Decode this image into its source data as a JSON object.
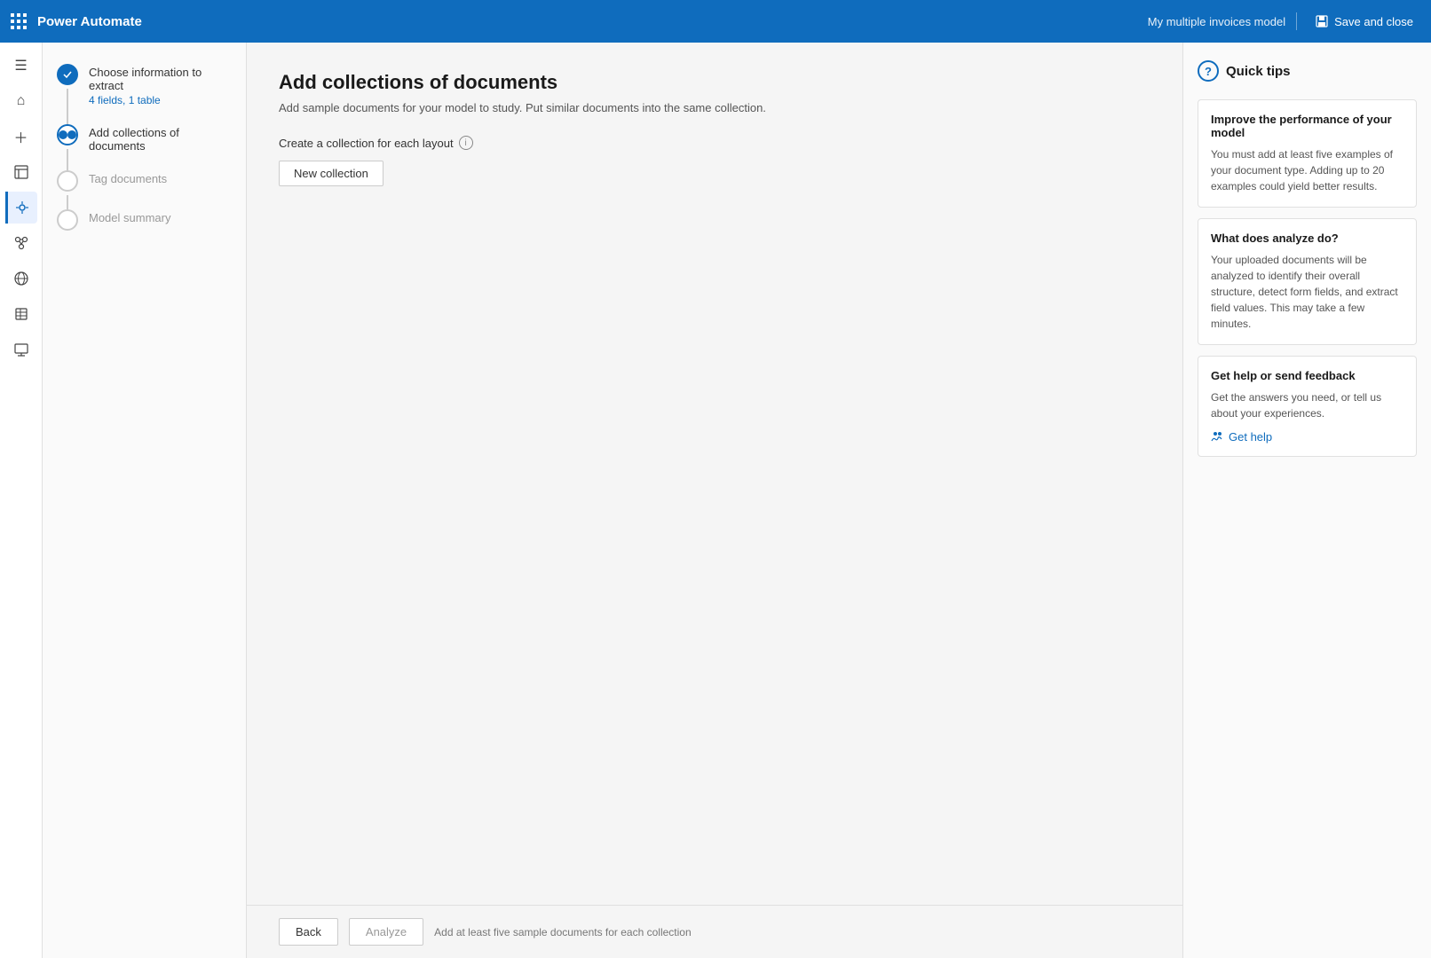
{
  "topbar": {
    "app_name": "Power Automate",
    "model_name": "My multiple invoices model",
    "save_close_label": "Save and close"
  },
  "steps": [
    {
      "id": "choose-info",
      "title": "Choose information to extract",
      "subtitle": "4 fields, 1 table",
      "state": "completed"
    },
    {
      "id": "add-collections",
      "title": "Add collections of documents",
      "subtitle": "",
      "state": "active"
    },
    {
      "id": "tag-documents",
      "title": "Tag documents",
      "subtitle": "",
      "state": "inactive"
    },
    {
      "id": "model-summary",
      "title": "Model summary",
      "subtitle": "",
      "state": "inactive"
    }
  ],
  "main": {
    "page_title": "Add collections of documents",
    "page_description": "Add sample documents for your model to study. Put similar documents into the same collection.",
    "section_label": "Create a collection for each layout",
    "new_collection_label": "New collection"
  },
  "bottom_bar": {
    "back_label": "Back",
    "analyze_label": "Analyze",
    "hint": "Add at least five sample documents for each collection"
  },
  "quick_tips": {
    "title": "Quick tips",
    "tips": [
      {
        "title": "Improve the performance of your model",
        "text": "You must add at least five examples of your document type. Adding up to 20 examples could yield better results."
      },
      {
        "title": "What does analyze do?",
        "text": "Your uploaded documents will be analyzed to identify their overall structure, detect form fields, and extract field values. This may take a few minutes."
      },
      {
        "title": "Get help or send feedback",
        "text": "Get the answers you need, or tell us about your experiences."
      }
    ],
    "get_help_label": "Get help"
  },
  "icon_sidebar": {
    "icons": [
      {
        "name": "menu-icon",
        "glyph": "☰"
      },
      {
        "name": "home-icon",
        "glyph": "⌂"
      },
      {
        "name": "create-icon",
        "glyph": "+"
      },
      {
        "name": "templates-icon",
        "glyph": "▤"
      },
      {
        "name": "ai-models-icon",
        "glyph": "✦"
      },
      {
        "name": "process-advisor-icon",
        "glyph": "◈"
      },
      {
        "name": "connections-icon",
        "glyph": "⊕"
      },
      {
        "name": "data-icon",
        "glyph": "❐"
      },
      {
        "name": "monitor-icon",
        "glyph": "◫"
      }
    ]
  }
}
